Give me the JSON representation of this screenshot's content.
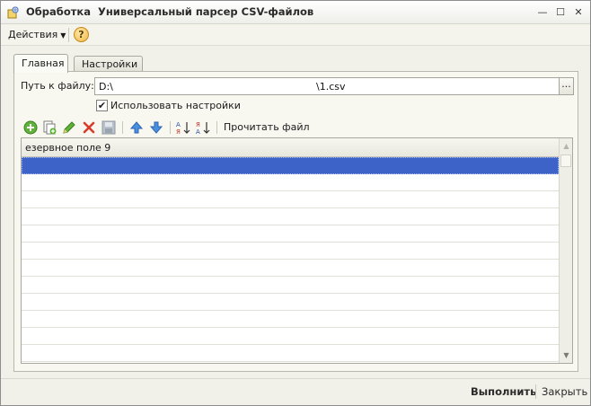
{
  "window": {
    "title": "Обработка  Универсальный парсер CSV-файлов",
    "minimize_glyph": "—",
    "maximize_glyph": "☐",
    "close_glyph": "✕"
  },
  "menu": {
    "actions_label": "Действия",
    "help_label": "?"
  },
  "tabs": [
    {
      "label": "Главная",
      "active": true
    },
    {
      "label": "Настройки",
      "active": false
    }
  ],
  "form": {
    "path_label": "Путь к файлу:",
    "path_value": "D:\\",
    "path_suffix": "\\1.csv",
    "browse_label": "...",
    "use_settings_label": "Использовать настройки",
    "use_settings_checked": true,
    "check_glyph": "✔"
  },
  "toolbar": {
    "buttons": [
      {
        "icon": "add-icon"
      },
      {
        "icon": "copy-icon"
      },
      {
        "icon": "edit-icon"
      },
      {
        "icon": "delete-icon"
      },
      {
        "icon": "save-icon"
      },
      {
        "icon": "move-up-icon"
      },
      {
        "icon": "move-down-icon"
      },
      {
        "icon": "sort-ascending-icon"
      },
      {
        "icon": "sort-descending-icon"
      }
    ],
    "read_file_label": "Прочитать файл"
  },
  "grid": {
    "column_header": "езервное поле 9",
    "selected_row": 0,
    "scroll_up_glyph": "▲",
    "scroll_down_glyph": "▼"
  },
  "footer": {
    "run_label": "Выполнить",
    "close_label": "Закрыть"
  },
  "colors": {
    "selection": "#3d63c9",
    "window_bg": "#f2f1e9"
  }
}
